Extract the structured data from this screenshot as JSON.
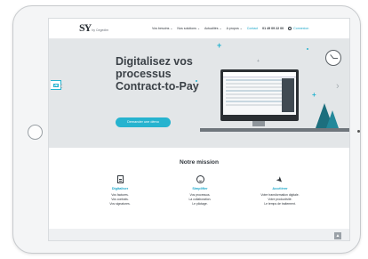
{
  "header": {
    "logo_mark": "SY",
    "logo_sub": "by Cegedim",
    "menu": [
      {
        "label": "Vos besoins ⌄"
      },
      {
        "label": "Nos solutions ⌄"
      },
      {
        "label": "Actualités ⌄"
      },
      {
        "label": "A propos ⌄"
      }
    ],
    "contact_label": "Contact",
    "phone": "01 49 09 22 00",
    "connexion_label": "Connexion"
  },
  "hero": {
    "title_lines": [
      "Digitalisez vos",
      "processus",
      "Contract-to-Pay"
    ],
    "cta_label": "Demander une démo",
    "prev_arrow": "‹",
    "next_arrow": "›"
  },
  "mission": {
    "title": "Notre mission",
    "columns": [
      {
        "icon": "document-icon",
        "name": "Digitaliser",
        "lines": [
          "Vos factures.",
          "Vos contrats.",
          "Vos signatures."
        ]
      },
      {
        "icon": "smile-icon",
        "name": "Simplifier",
        "lines": [
          "Vos processus.",
          "La collaboration.",
          "Le pilotage."
        ]
      },
      {
        "icon": "rocket-icon",
        "name": "Accélérer",
        "lines": [
          "Votre transformation digitale.",
          "Votre productivité.",
          "Le temps de traitement."
        ]
      }
    ]
  },
  "colors": {
    "accent": "#26b3cf",
    "text": "#30363c",
    "hero_bg": "#e3e6e8"
  }
}
